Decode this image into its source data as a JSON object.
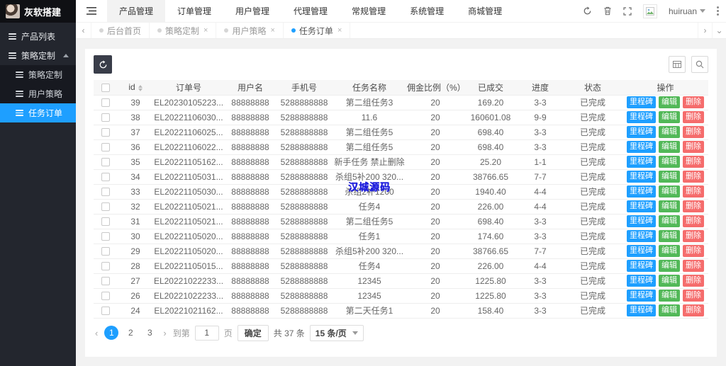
{
  "brand": {
    "title": "灰软搭建"
  },
  "header": {
    "nav": [
      {
        "key": "product",
        "label": "产品管理",
        "active": true
      },
      {
        "key": "order",
        "label": "订单管理",
        "active": false
      },
      {
        "key": "user",
        "label": "用户管理",
        "active": false
      },
      {
        "key": "agent",
        "label": "代理管理",
        "active": false
      },
      {
        "key": "general",
        "label": "常规管理",
        "active": false
      },
      {
        "key": "system",
        "label": "系统管理",
        "active": false
      },
      {
        "key": "mall",
        "label": "商城管理",
        "active": false
      }
    ],
    "username": "huiruan"
  },
  "sidebar": {
    "items": [
      {
        "key": "product-list",
        "label": "产品列表",
        "type": "top",
        "active": false,
        "expanded": false
      },
      {
        "key": "strategy-group",
        "label": "策略定制",
        "type": "top",
        "active": false,
        "expanded": true
      },
      {
        "key": "strategy-config",
        "label": "策略定制",
        "type": "sub",
        "active": false
      },
      {
        "key": "user-strategy",
        "label": "用户策略",
        "type": "sub",
        "active": false
      },
      {
        "key": "task-orders",
        "label": "任务订单",
        "type": "sub",
        "active": true
      }
    ]
  },
  "tabs": [
    {
      "key": "dashboard",
      "label": "后台首页",
      "closable": false,
      "active": false
    },
    {
      "key": "strategy-config",
      "label": "策略定制",
      "closable": true,
      "active": false
    },
    {
      "key": "user-strategy",
      "label": "用户策略",
      "closable": true,
      "active": false
    },
    {
      "key": "task-orders",
      "label": "任务订单",
      "closable": true,
      "active": true
    }
  ],
  "table": {
    "columns": [
      {
        "key": "id",
        "label": "id",
        "sortable": true
      },
      {
        "key": "order_no",
        "label": "订单号"
      },
      {
        "key": "username",
        "label": "用户名"
      },
      {
        "key": "phone",
        "label": "手机号"
      },
      {
        "key": "task",
        "label": "任务名称"
      },
      {
        "key": "commission",
        "label": "佣金比例（%）"
      },
      {
        "key": "completed",
        "label": "已成交"
      },
      {
        "key": "progress",
        "label": "进度"
      },
      {
        "key": "status",
        "label": "状态"
      },
      {
        "key": "actions",
        "label": "操作"
      }
    ],
    "actions": [
      {
        "key": "milestone",
        "label": "里程碑",
        "color": "#1e9fff"
      },
      {
        "key": "edit",
        "label": "编辑",
        "color": "#52b858"
      },
      {
        "key": "delete",
        "label": "删除",
        "color": "#f56c6c"
      }
    ],
    "rows": [
      {
        "id": "39",
        "order_no": "EL20230105223...",
        "username": "88888888",
        "phone": "5288888888",
        "task": "第二组任务3",
        "commission": "20",
        "completed": "169.20",
        "progress": "3-3",
        "status": "已完成"
      },
      {
        "id": "38",
        "order_no": "EL20221106030...",
        "username": "88888888",
        "phone": "5288888888",
        "task": "11.6",
        "commission": "20",
        "completed": "160601.08",
        "progress": "9-9",
        "status": "已完成"
      },
      {
        "id": "37",
        "order_no": "EL20221106025...",
        "username": "88888888",
        "phone": "5288888888",
        "task": "第二组任务5",
        "commission": "20",
        "completed": "698.40",
        "progress": "3-3",
        "status": "已完成"
      },
      {
        "id": "36",
        "order_no": "EL20221106022...",
        "username": "88888888",
        "phone": "5288888888",
        "task": "第二组任务5",
        "commission": "20",
        "completed": "698.40",
        "progress": "3-3",
        "status": "已完成"
      },
      {
        "id": "35",
        "order_no": "EL20221105162...",
        "username": "88888888",
        "phone": "5288888888",
        "task": "新手任务 禁止删除",
        "commission": "20",
        "completed": "25.20",
        "progress": "1-1",
        "status": "已完成"
      },
      {
        "id": "34",
        "order_no": "EL20221105031...",
        "username": "88888888",
        "phone": "5288888888",
        "task": "杀组5补200 320...",
        "commission": "20",
        "completed": "38766.65",
        "progress": "7-7",
        "status": "已完成"
      },
      {
        "id": "33",
        "order_no": "EL20221105030...",
        "username": "88888888",
        "phone": "5288888888",
        "task": "杀组2补1200",
        "commission": "20",
        "completed": "1940.40",
        "progress": "4-4",
        "status": "已完成"
      },
      {
        "id": "32",
        "order_no": "EL20221105021...",
        "username": "88888888",
        "phone": "5288888888",
        "task": "任务4",
        "commission": "20",
        "completed": "226.00",
        "progress": "4-4",
        "status": "已完成"
      },
      {
        "id": "31",
        "order_no": "EL20221105021...",
        "username": "88888888",
        "phone": "5288888888",
        "task": "第二组任务5",
        "commission": "20",
        "completed": "698.40",
        "progress": "3-3",
        "status": "已完成"
      },
      {
        "id": "30",
        "order_no": "EL20221105020...",
        "username": "88888888",
        "phone": "5288888888",
        "task": "任务1",
        "commission": "20",
        "completed": "174.60",
        "progress": "3-3",
        "status": "已完成"
      },
      {
        "id": "29",
        "order_no": "EL20221105020...",
        "username": "88888888",
        "phone": "5288888888",
        "task": "杀组5补200 320...",
        "commission": "20",
        "completed": "38766.65",
        "progress": "7-7",
        "status": "已完成"
      },
      {
        "id": "28",
        "order_no": "EL20221105015...",
        "username": "88888888",
        "phone": "5288888888",
        "task": "任务4",
        "commission": "20",
        "completed": "226.00",
        "progress": "4-4",
        "status": "已完成"
      },
      {
        "id": "27",
        "order_no": "EL20221022233...",
        "username": "88888888",
        "phone": "5288888888",
        "task": "12345",
        "commission": "20",
        "completed": "1225.80",
        "progress": "3-3",
        "status": "已完成"
      },
      {
        "id": "26",
        "order_no": "EL20221022233...",
        "username": "88888888",
        "phone": "5288888888",
        "task": "12345",
        "commission": "20",
        "completed": "1225.80",
        "progress": "3-3",
        "status": "已完成"
      },
      {
        "id": "24",
        "order_no": "EL20221021162...",
        "username": "88888888",
        "phone": "5288888888",
        "task": "第二天任务1",
        "commission": "20",
        "completed": "158.40",
        "progress": "3-3",
        "status": "已完成"
      }
    ]
  },
  "pagination": {
    "pages": [
      "1",
      "2",
      "3"
    ],
    "active_page": "1",
    "jump_label": "到第",
    "page_input": "1",
    "page_unit": "页",
    "confirm_label": "确定",
    "total_label": "共 37 条",
    "page_size_label": "15 条/页"
  },
  "watermark": "汉城源码",
  "icons": {
    "hamburger": "list-menu",
    "refresh": "circular-arrow",
    "trash": "trash-can",
    "fullscreen": "expand-arrows",
    "user-caret": "caret-down",
    "more": "vertical-dots",
    "tab-prev": "chevron-left",
    "tab-next": "chevron-right",
    "tab-collapse": "chevron-down",
    "columns": "grid",
    "search": "magnifier",
    "sort": "up-down-carets",
    "menu-item": "list-lines",
    "submenu-collapse": "caret-up",
    "image-placeholder": "photo"
  },
  "colors": {
    "accent": "#1e9fff",
    "sidebar_bg": "#23262e",
    "sidebar_sub_bg": "#171920",
    "toolbar_dark": "#393d49",
    "milestone_btn": "#1e9fff",
    "edit_btn": "#52b858",
    "delete_btn": "#f56c6c",
    "watermark_blue": "#2222dd"
  }
}
